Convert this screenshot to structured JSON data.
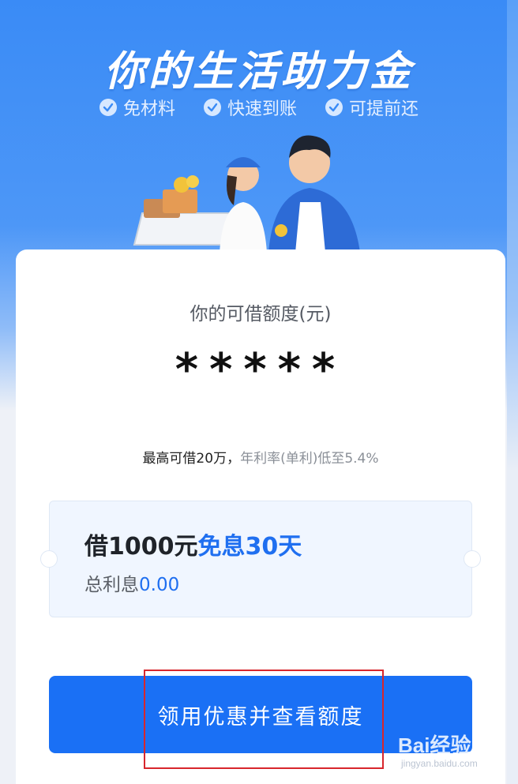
{
  "hero": {
    "headline": "你的生活助力金",
    "features": [
      "免材料",
      "快速到账",
      "可提前还"
    ]
  },
  "card": {
    "limit_label": "你的可借额度(元)",
    "limit_value": "*****",
    "rate_main": "最高可借20万，",
    "rate_sub": "年利率(单利)低至5.4%"
  },
  "coupon": {
    "title_prefix": "借1000元",
    "title_highlight": "免息30天",
    "interest_label": "总利息",
    "interest_value": "0.00"
  },
  "cta": {
    "label": "领用优惠并查看额度"
  },
  "watermark": {
    "main": "Bai经验",
    "sub": "jingyan.baidu.com"
  },
  "colors": {
    "accent": "#1a70f5",
    "highlight_box": "#d8262c",
    "hero_top": "#3a8bf6"
  }
}
